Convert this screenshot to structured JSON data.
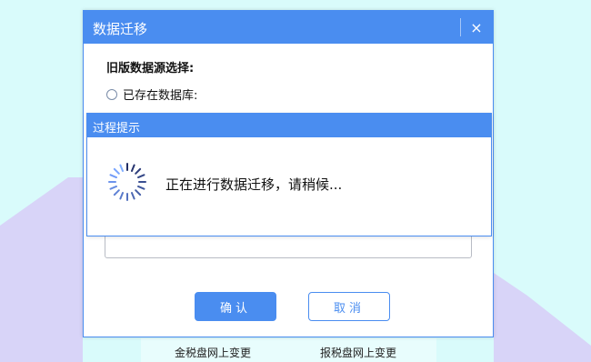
{
  "dialog": {
    "title": "数据迁移",
    "close_glyph": "×",
    "section_label": "旧版数据源选择:",
    "radio_option_label": "已存在数据库:",
    "ok_label": "确认",
    "cancel_label": "取消"
  },
  "progress": {
    "title": "过程提示",
    "message": "正在进行数据迁移，请稍候..."
  },
  "bottom_links": {
    "link1": "金税盘网上变更",
    "link2": "报税盘网上变更"
  },
  "colors": {
    "accent": "#4a8df0",
    "background": "#d9fbfb",
    "mountain": "#d8d4f8"
  },
  "icons": {
    "close": "close-icon",
    "spinner": "loading-spinner-icon",
    "radio": "radio-button"
  }
}
